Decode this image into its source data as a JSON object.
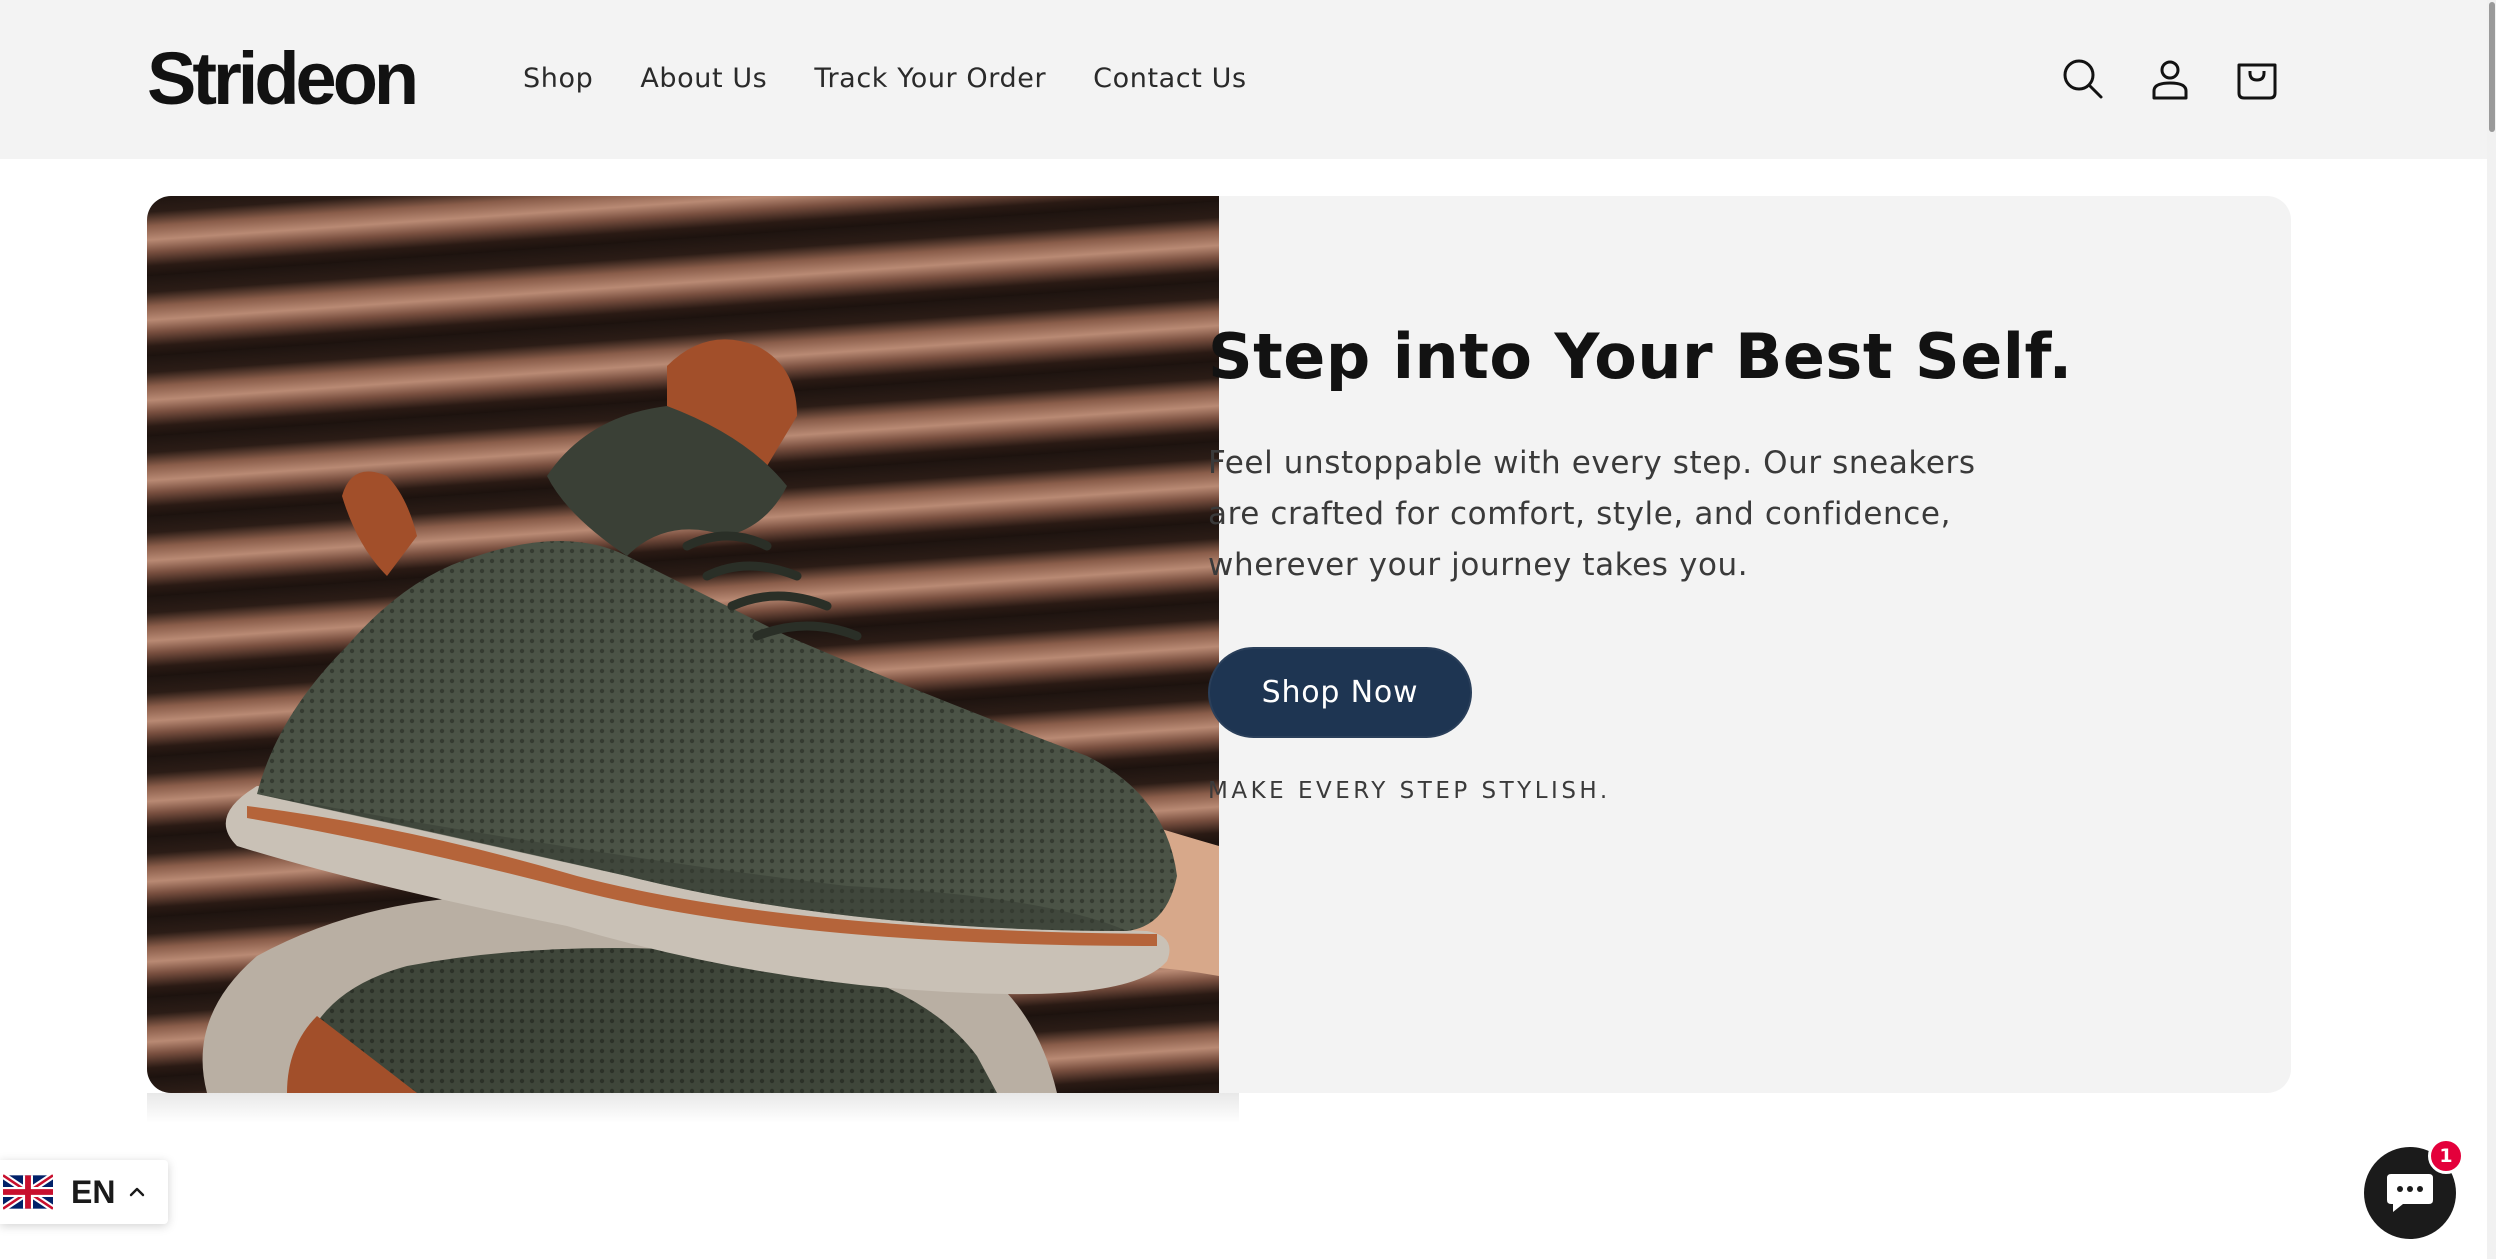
{
  "header": {
    "logo_text": "Strideon",
    "nav": [
      {
        "label": "Shop"
      },
      {
        "label": "About Us"
      },
      {
        "label": "Track Your Order"
      },
      {
        "label": "Contact Us"
      }
    ],
    "icons": [
      "search-icon",
      "account-icon",
      "cart-icon"
    ]
  },
  "hero": {
    "title": "Step into Your Best Self.",
    "text": "Feel unstoppable with every step. Our sneakers are crafted for comfort, style, and confidence, wherever your journey takes you.",
    "button_label": "Shop Now",
    "tagline": "MAKE EVERY STEP STYLISH.",
    "image_subject": "knit sneaker held in hand"
  },
  "language": {
    "code": "EN",
    "flag": "uk-flag-icon"
  },
  "chat": {
    "badge_count": "1",
    "icon": "chat-bubble-icon"
  },
  "colors": {
    "header_bg": "#f3f3f3",
    "button_bg": "#1e3552",
    "badge": "#e4003b"
  }
}
